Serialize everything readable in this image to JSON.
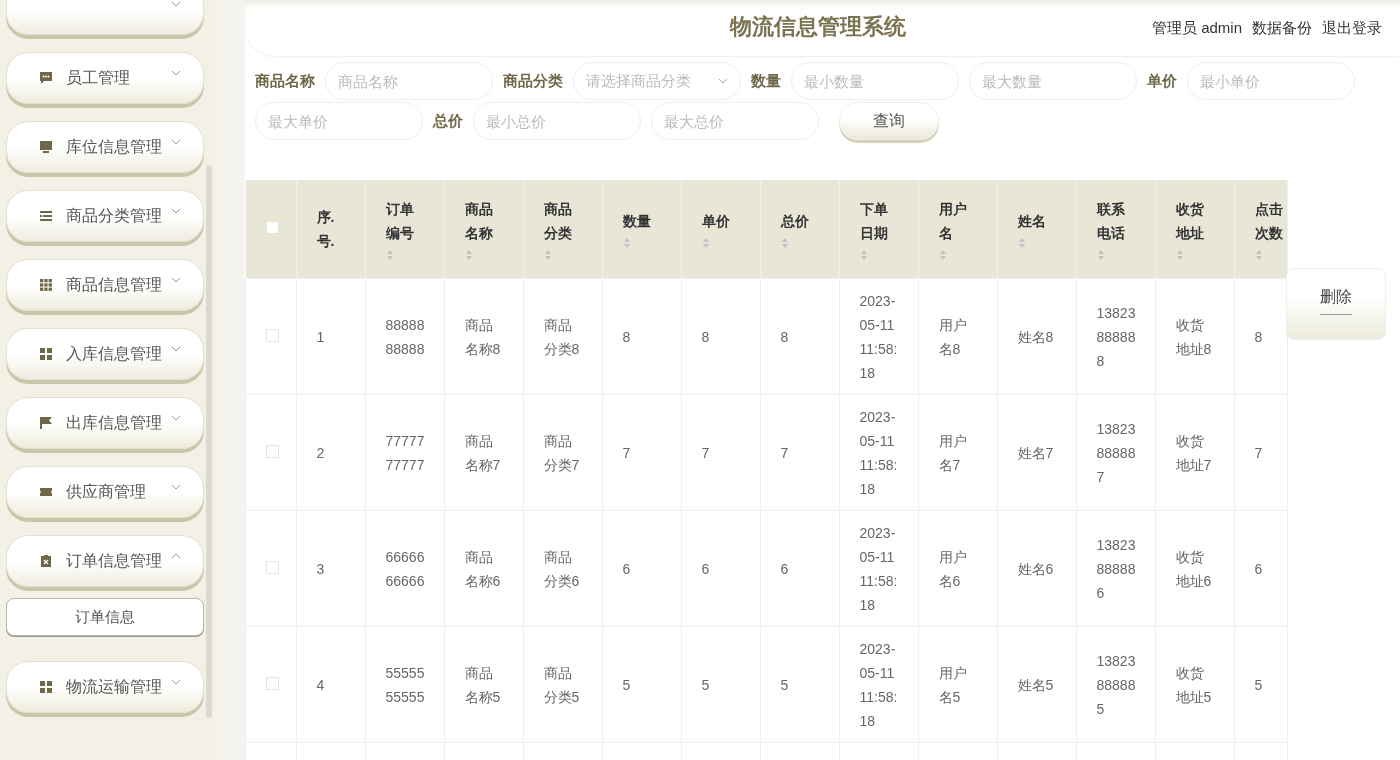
{
  "header": {
    "title": "物流信息管理系统",
    "user": "管理员 admin",
    "links": [
      "数据备份",
      "退出登录"
    ]
  },
  "sidebar": {
    "items": [
      {
        "expanded": false
      },
      {
        "label": "员工管理",
        "expanded": false
      },
      {
        "label": "库位信息管理",
        "expanded": false
      },
      {
        "label": "商品分类管理",
        "expanded": false
      },
      {
        "label": "商品信息管理",
        "expanded": false
      },
      {
        "label": "入库信息管理",
        "expanded": false
      },
      {
        "label": "出库信息管理",
        "expanded": false
      },
      {
        "label": "供应商管理",
        "expanded": false
      },
      {
        "label": "订单信息管理",
        "expanded": true,
        "children": [
          {
            "label": "订单信息"
          }
        ]
      },
      {
        "label": "物流运输管理",
        "expanded": false
      }
    ]
  },
  "search": {
    "fields": [
      {
        "label": "商品名称",
        "kind": "text",
        "placeholders": [
          "商品名称"
        ]
      },
      {
        "label": "商品分类",
        "kind": "select",
        "placeholders": [
          "请选择商品分类"
        ]
      },
      {
        "label": "数量",
        "kind": "range",
        "placeholders": [
          "最小数量",
          "最大数量"
        ]
      },
      {
        "label": "单价",
        "kind": "range",
        "placeholders": [
          "最小单价",
          "最大单价"
        ]
      },
      {
        "label": "总价",
        "kind": "range",
        "placeholders": [
          "最小总价",
          "最大总价"
        ]
      }
    ],
    "button": "查询"
  },
  "actions": [
    "删除"
  ],
  "table": {
    "columns": [
      {
        "label": "序.号.",
        "sortable": false
      },
      {
        "label": "订单编号",
        "sortable": true
      },
      {
        "label": "商品名称",
        "sortable": true
      },
      {
        "label": "商品分类",
        "sortable": true
      },
      {
        "label": "数量",
        "sortable": true
      },
      {
        "label": "单价",
        "sortable": true
      },
      {
        "label": "总价",
        "sortable": true
      },
      {
        "label": "下单日期",
        "sortable": true
      },
      {
        "label": "用户名",
        "sortable": true
      },
      {
        "label": "姓名",
        "sortable": true
      },
      {
        "label": "联系电话",
        "sortable": true
      },
      {
        "label": "收货地址",
        "sortable": true
      },
      {
        "label": "点击次数",
        "sortable": true
      }
    ],
    "all_checked": false,
    "rows": [
      {
        "checked": false,
        "cells": [
          "1",
          "8888888888",
          "商品名称8",
          "商品分类8",
          "8",
          "8",
          "8",
          "2023-05-11 11:58:18",
          "用户名8",
          "姓名8",
          "13823888888",
          "收货地址8",
          "8"
        ]
      },
      {
        "checked": false,
        "cells": [
          "2",
          "7777777777",
          "商品名称7",
          "商品分类7",
          "7",
          "7",
          "7",
          "2023-05-11 11:58:18",
          "用户名7",
          "姓名7",
          "13823888887",
          "收货地址7",
          "7"
        ]
      },
      {
        "checked": false,
        "cells": [
          "3",
          "6666666666",
          "商品名称6",
          "商品分类6",
          "6",
          "6",
          "6",
          "2023-05-11 11:58:18",
          "用户名6",
          "姓名6",
          "13823888886",
          "收货地址6",
          "6"
        ]
      },
      {
        "checked": false,
        "cells": [
          "4",
          "5555555555",
          "商品名称5",
          "商品分类5",
          "5",
          "5",
          "5",
          "2023-05-11 11:58:18",
          "用户名5",
          "姓名5",
          "13823888885",
          "收货地址5",
          "5"
        ]
      }
    ]
  }
}
